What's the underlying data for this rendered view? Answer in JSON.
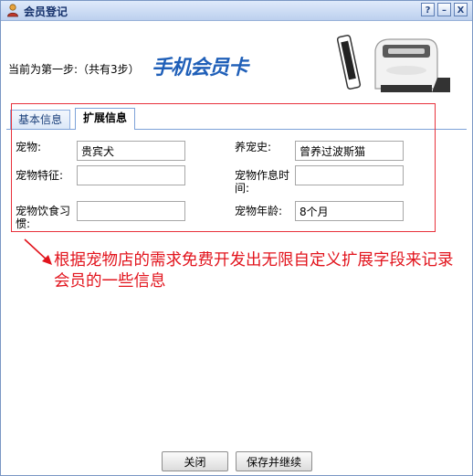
{
  "window": {
    "title": "会员登记",
    "help_label": "?",
    "minimize_label": "–",
    "close_label": "X"
  },
  "step": {
    "text": "当前为第一步:（共有3步）"
  },
  "brand": {
    "text": "手机会员卡"
  },
  "tabs": [
    {
      "label": "基本信息",
      "active": false
    },
    {
      "label": "扩展信息",
      "active": true
    }
  ],
  "fields": {
    "pet": {
      "label": "宠物:",
      "value": "贵宾犬"
    },
    "pet_history": {
      "label": "养宠史:",
      "value": "曾养过波斯猫"
    },
    "pet_features": {
      "label": "宠物特征:",
      "value": ""
    },
    "pet_schedule": {
      "label": "宠物作息时间:",
      "value": ""
    },
    "pet_diet": {
      "label": "宠物饮食习惯:",
      "value": ""
    },
    "pet_age": {
      "label": "宠物年龄:",
      "value": "8个月"
    }
  },
  "annotation": {
    "text": "根据宠物店的需求免费开发出无限自定义扩展字段来记录会员的一些信息",
    "color": "#e2141d"
  },
  "buttons": {
    "close_label": "关闭",
    "save_continue_label": "保存并继续"
  },
  "colors": {
    "titlebar": "#bcd0ee",
    "tab_border": "#7da2d8",
    "annotation_box": "#e8323c"
  }
}
